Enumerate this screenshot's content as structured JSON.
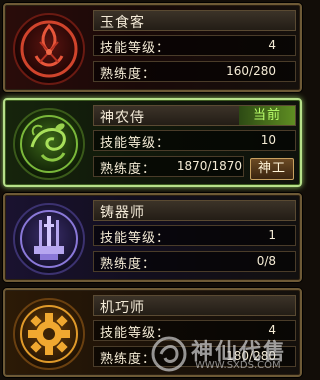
{
  "skills": [
    {
      "name": "玉食客",
      "level_label": "技能等级：",
      "level": "4",
      "exp_label": "熟练度：",
      "exp": "160/280",
      "icon": "fish-flame-emblem-icon",
      "accent": "#c2402a"
    },
    {
      "name": "神农侍",
      "current_label": "当前",
      "level_label": "技能等级：",
      "level": "10",
      "exp_label": "熟练度：",
      "exp": "1870/1870",
      "action_label": "神工",
      "icon": "green-vine-emblem-icon",
      "accent": "#5e9a2a"
    },
    {
      "name": "铸器师",
      "level_label": "技能等级：",
      "level": "1",
      "exp_label": "熟练度：",
      "exp": "0/8",
      "icon": "anvil-swords-emblem-icon",
      "accent": "#7a66c8"
    },
    {
      "name": "机巧师",
      "level_label": "技能等级：",
      "level": "4",
      "exp_label": "熟练度：",
      "exp": "180/280",
      "icon": "gear-emblem-icon",
      "accent": "#d8891c"
    }
  ],
  "watermark": {
    "text": "神仙代售",
    "url": "WWW.SXDS.COM"
  }
}
